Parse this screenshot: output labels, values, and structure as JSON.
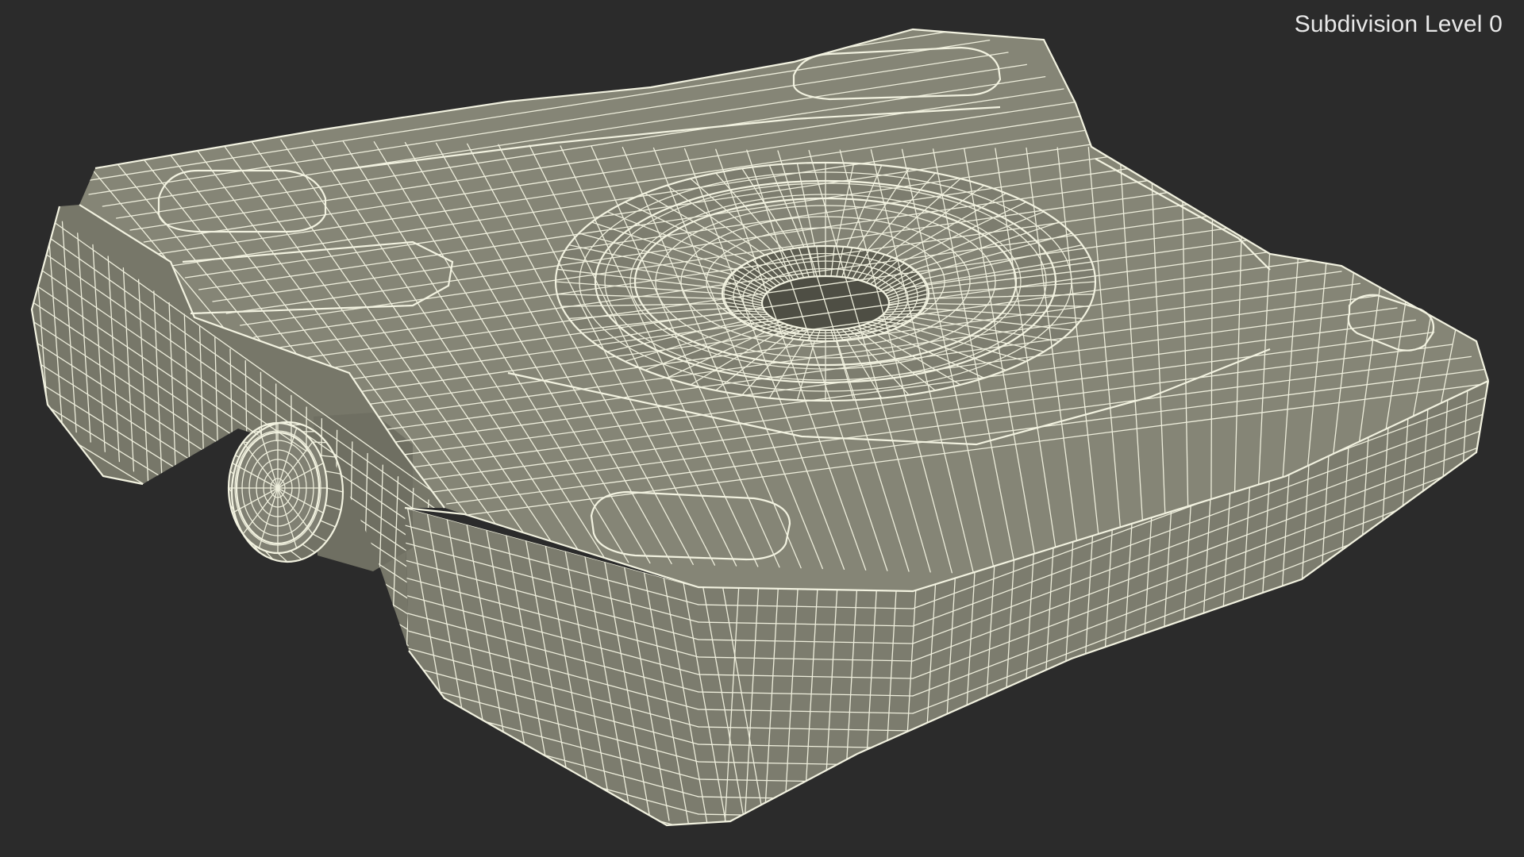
{
  "viewport": {
    "overlay_label": "Subdivision Level 0",
    "background_color": "#2b2b2b",
    "mesh_surface_color": "#7f7f71",
    "mesh_wire_color": "#eeeedc",
    "object": "wireframe-3d-model"
  }
}
